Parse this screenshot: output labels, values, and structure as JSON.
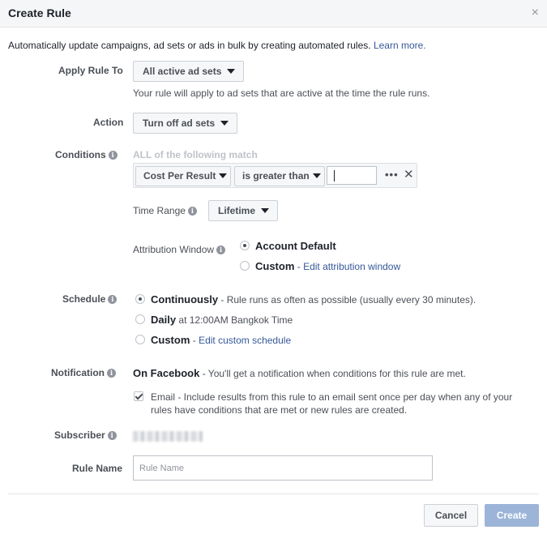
{
  "dialog": {
    "title": "Create Rule",
    "close_glyph": "×",
    "intro_text": "Automatically update campaigns, ad sets or ads in bulk by creating automated rules.",
    "intro_link": "Learn more."
  },
  "apply_rule_to": {
    "label": "Apply Rule To",
    "value": "All active ad sets",
    "helper": "Your rule will apply to ad sets that are active at the time the rule runs."
  },
  "action": {
    "label": "Action",
    "value": "Turn off ad sets"
  },
  "conditions": {
    "label": "Conditions",
    "match_text": "ALL of the following match",
    "metric": "Cost Per Result",
    "operator": "is greater than",
    "value": "",
    "more_glyph": "•••",
    "remove_glyph": "✕"
  },
  "time_range": {
    "label": "Time Range",
    "value": "Lifetime"
  },
  "attribution_window": {
    "label": "Attribution Window",
    "options": [
      {
        "label": "Account Default",
        "selected": true
      },
      {
        "label": "Custom",
        "link": "Edit attribution window",
        "selected": false
      }
    ],
    "separator": " - "
  },
  "schedule": {
    "label": "Schedule",
    "options": [
      {
        "label": "Continuously",
        "detail": " - Rule runs as often as possible (usually every 30 minutes).",
        "selected": true
      },
      {
        "label": "Daily",
        "detail": " at 12:00AM Bangkok Time",
        "selected": false
      },
      {
        "label": "Custom",
        "detail": " - ",
        "link": "Edit custom schedule",
        "selected": false
      }
    ]
  },
  "notification": {
    "label": "Notification",
    "title": "On Facebook",
    "detail": " - You'll get a notification when conditions for this rule are met.",
    "email_checked": true,
    "email_line1": "Email - Include results from this rule to an email sent once per day when any of your",
    "email_line2": "rules have conditions that are met or new rules are created."
  },
  "subscriber": {
    "label": "Subscriber"
  },
  "rule_name": {
    "label": "Rule Name",
    "value": "",
    "placeholder": "Rule Name"
  },
  "footer": {
    "cancel_label": "Cancel",
    "create_label": "Create"
  },
  "icons": {
    "info_glyph": "i"
  },
  "colors": {
    "link": "#365899",
    "create_disabled": "#9cb4d8",
    "header_bg": "#f5f6f7"
  }
}
